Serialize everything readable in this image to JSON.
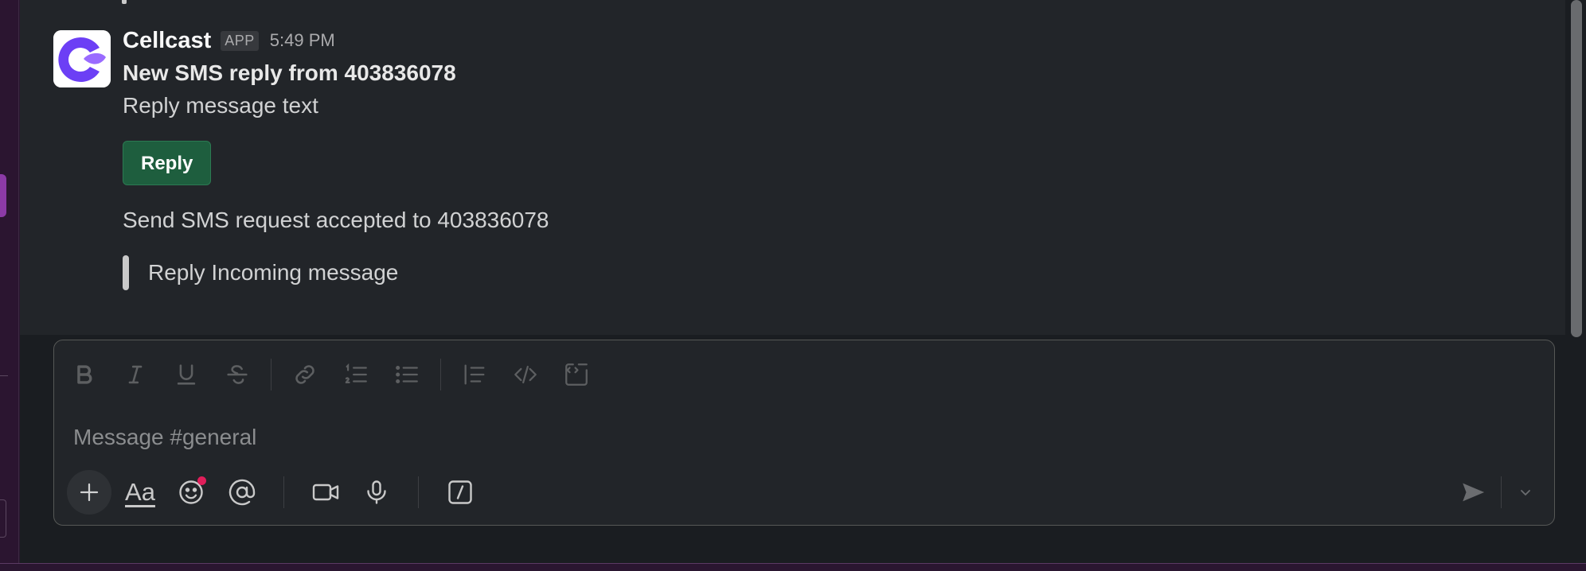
{
  "message": {
    "sender": "Cellcast",
    "badge": "APP",
    "time": "5:49 PM",
    "title": "New SMS reply from 403836078",
    "text": "Reply message text",
    "reply_button": "Reply",
    "send_status": "Send SMS request accepted to 403836078",
    "quote": "Reply Incoming message"
  },
  "composer": {
    "placeholder": "Message #general",
    "format_tools": [
      "bold-icon",
      "italic-icon",
      "underline-icon",
      "strikethrough-icon",
      "link-icon",
      "ordered-list-icon",
      "bullet-list-icon",
      "blockquote-icon",
      "code-icon",
      "code-block-icon"
    ],
    "action_tools": [
      "plus-icon",
      "formatting-icon",
      "emoji-icon",
      "mention-icon",
      "video-icon",
      "microphone-icon",
      "slash-command-icon"
    ],
    "formatting_label": "Aa"
  },
  "colors": {
    "reply_button": "#1e5e3e",
    "avatar_accent": "#6c3ff5",
    "notification_dot": "#e01e5a"
  }
}
